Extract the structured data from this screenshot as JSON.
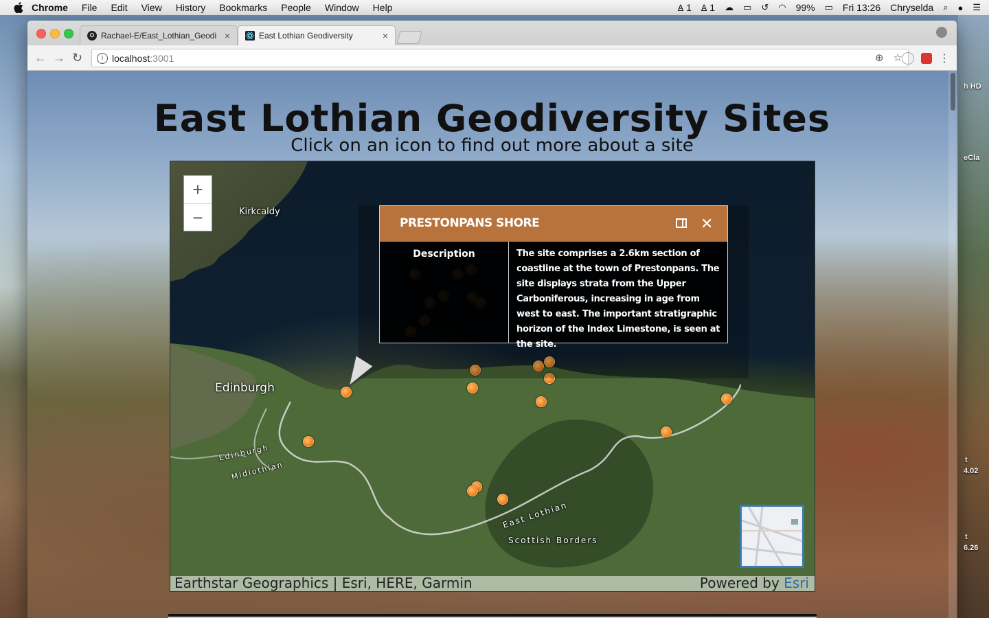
{
  "menubar": {
    "app": "Chrome",
    "menus": [
      "File",
      "Edit",
      "View",
      "History",
      "Bookmarks",
      "People",
      "Window",
      "Help"
    ],
    "status": {
      "adobe1": "1",
      "adobe2": "1",
      "battery": "99%",
      "clock": "Fri 13:26",
      "user": "Chryselda"
    }
  },
  "desktop": {
    "labels": [
      "h HD",
      "eCla",
      "t",
      "4.02",
      "t",
      "6.26"
    ]
  },
  "browser": {
    "tabs": [
      {
        "label": "Rachael-E/East_Lothian_Geodi",
        "icon": "github-icon"
      },
      {
        "label": "East Lothian Geodiversity",
        "icon": "react-icon"
      }
    ],
    "url_host": "localhost",
    "url_port": ":3001"
  },
  "page": {
    "title": "East Lothian Geodiversity Sites",
    "subtitle": "Click on an icon to find out more about a site"
  },
  "map": {
    "places": {
      "kirkcaldy": "Kirkcaldy",
      "edinburgh": "Edinburgh",
      "edinburgh_border": "Edinburgh",
      "midlothian": "Midlothian",
      "east_lothian": "East Lothian",
      "scottish_borders": "Scottish Borders"
    },
    "attribution": "Earthstar Geographics | Esri, HERE, Garmin",
    "powered_by": "Powered by",
    "powered_by_brand": "Esri",
    "popup": {
      "title": "PRESTONPANS SHORE",
      "field_name": "Description",
      "field_value": "The site comprises a 2.6km section of coastline at the town of Prestonpans. The site displays strata from the Upper Carboniferous, increasing in age from west to east. The important stratigraphic horizon of the Index Limestone, is seen at the site."
    },
    "colors": {
      "popup_header": "#b8733c",
      "marker": "#f07a10",
      "sea": "#0d1c2b"
    }
  }
}
